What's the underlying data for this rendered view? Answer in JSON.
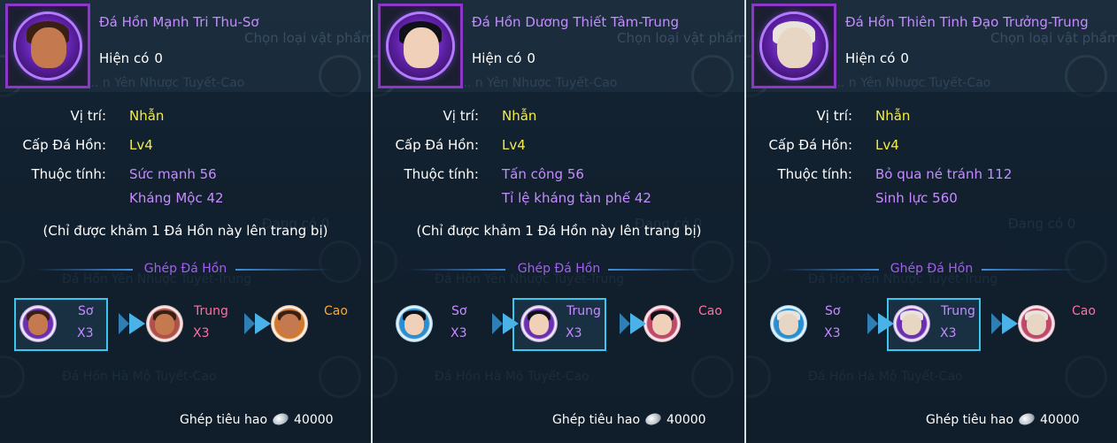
{
  "background": {
    "right_top": "Chọn loại vật phẩm",
    "rows": [
      "... n Yên Nhược Tuyết-Cao",
      "Đá Hồn Yên Nhược Tuyết-Trung",
      "Đá Hồn Hà Mộ Tuyết-Cao"
    ],
    "right_mid": "Đang có 0"
  },
  "panels": [
    {
      "title": "Đá Hồn Mạnh Tri Thu-Sơ",
      "have_label": "Hiện có",
      "have_value": "0",
      "position_label": "Vị trí:",
      "position_value": "Nhẫn",
      "level_label": "Cấp Đá Hồn:",
      "level_value": "Lv4",
      "attr_label": "Thuộc tính:",
      "attrs": [
        "Sức mạnh  56",
        "Kháng Mộc  42"
      ],
      "note": "(Chỉ được khảm 1 Đá Hồn này lên trang bị)",
      "section": "Ghép Đá Hồn",
      "chain": [
        {
          "tier": "Sơ",
          "count": "X3",
          "tier_color": "#c58cff"
        },
        {
          "tier": "Trung",
          "count": "X3",
          "tier_color": "#ff6fa0"
        },
        {
          "tier": "Cao",
          "count": "",
          "tier_color": "#ffa728"
        }
      ],
      "selected_index": 0,
      "cost_label": "Ghép tiêu hao",
      "cost_value": "40000"
    },
    {
      "title": "Đá Hồn Dương Thiết Tâm-Trung",
      "have_label": "Hiện có",
      "have_value": "0",
      "position_label": "Vị trí:",
      "position_value": "Nhẫn",
      "level_label": "Cấp Đá Hồn:",
      "level_value": "Lv4",
      "attr_label": "Thuộc tính:",
      "attrs": [
        "Tấn công  56",
        "Tỉ lệ kháng tàn phế  42"
      ],
      "note": "(Chỉ được khảm 1 Đá Hồn này lên trang bị)",
      "section": "Ghép Đá Hồn",
      "chain": [
        {
          "tier": "Sơ",
          "count": "X3",
          "tier_color": "#c58cff"
        },
        {
          "tier": "Trung",
          "count": "X3",
          "tier_color": "#c58cff"
        },
        {
          "tier": "Cao",
          "count": "",
          "tier_color": "#ff6fa0"
        }
      ],
      "selected_index": 1,
      "cost_label": "Ghép tiêu hao",
      "cost_value": "40000"
    },
    {
      "title": "Đá Hồn Thiên Tinh Đạo Trưởng-Trung",
      "have_label": "Hiện có",
      "have_value": "0",
      "position_label": "Vị trí:",
      "position_value": "Nhẫn",
      "level_label": "Cấp Đá Hồn:",
      "level_value": "Lv4",
      "attr_label": "Thuộc tính:",
      "attrs": [
        "Bỏ qua né tránh  112",
        "Sinh lực  560"
      ],
      "note": "",
      "section": "Ghép Đá Hồn",
      "chain": [
        {
          "tier": "Sơ",
          "count": "X3",
          "tier_color": "#c58cff"
        },
        {
          "tier": "Trung",
          "count": "X3",
          "tier_color": "#c58cff"
        },
        {
          "tier": "Cao",
          "count": "",
          "tier_color": "#ff6fa0"
        }
      ],
      "selected_index": 1,
      "cost_label": "Ghép tiêu hao",
      "cost_value": "40000"
    }
  ],
  "colors": {
    "title": "#c58cff",
    "value_yellow": "#f4ec48",
    "frame_purple": "#8a38c6",
    "select_cyan": "#39c7f0"
  }
}
